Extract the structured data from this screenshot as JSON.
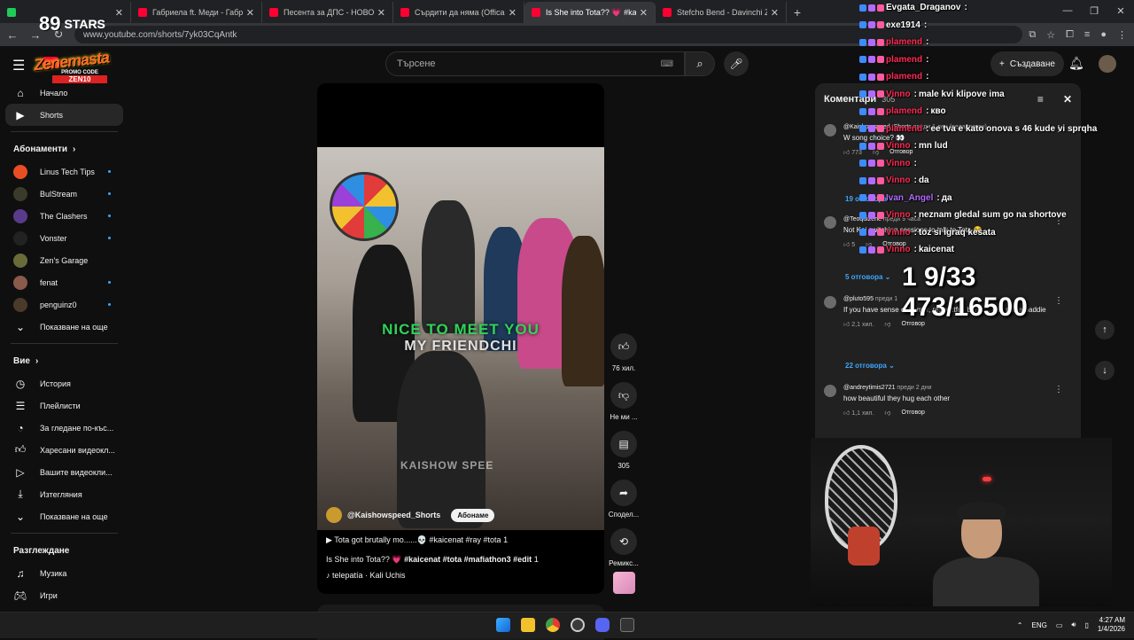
{
  "browser": {
    "tabs": [
      {
        "title": "",
        "favicon": "green"
      },
      {
        "title": "Габриела ft. Меди - Габриела",
        "favicon": "red"
      },
      {
        "title": "Песента за ДПС - НОВО НАЧА",
        "favicon": "red"
      },
      {
        "title": "Сърдити да няма (Offical AI An",
        "favicon": "red"
      },
      {
        "title": "Is She into Tota?? 💗 #kai",
        "favicon": "red",
        "active": true
      },
      {
        "title": "Stefcho Bend - Davinchi Zakon",
        "favicon": "red"
      }
    ],
    "url": "www.youtube.com/shorts/7yk03CqAntk"
  },
  "masthead": {
    "search_placeholder": "Търсене",
    "create_label": "Създаване"
  },
  "sidebar": {
    "top": [
      {
        "label": "Начало",
        "icon": "home-icon"
      },
      {
        "label": "Shorts",
        "icon": "shorts-icon",
        "active": true
      }
    ],
    "subs_header": "Абонаменти",
    "subs": [
      {
        "label": "Linus Tech Tips",
        "color": "#e84d23"
      },
      {
        "label": "BulStream",
        "color": "#3b3b2b"
      },
      {
        "label": "The Clashers",
        "color": "#5a3a8a"
      },
      {
        "label": "Vonster",
        "color": "#222222"
      },
      {
        "label": "Zen's Garage",
        "color": "#6b6b3a"
      },
      {
        "label": "fenat",
        "color": "#8a5a4a"
      },
      {
        "label": "penguinz0",
        "color": "#4a3a2a"
      }
    ],
    "subs_more": "Показване на още",
    "you_header": "Вие",
    "you": [
      {
        "label": "История",
        "icon": "history-icon"
      },
      {
        "label": "Плейлисти",
        "icon": "playlists-icon"
      },
      {
        "label": "За гледане по-къс...",
        "icon": "watch-later-icon"
      },
      {
        "label": "Харесани видеокл...",
        "icon": "liked-icon"
      },
      {
        "label": "Вашите видеокли...",
        "icon": "your-videos-icon"
      },
      {
        "label": "Изтегляния",
        "icon": "downloads-icon"
      }
    ],
    "you_more": "Показване на още",
    "explore_header": "Разглеждане",
    "explore": [
      {
        "label": "Музика",
        "icon": "music-icon"
      },
      {
        "label": "Игри",
        "icon": "games-icon"
      }
    ]
  },
  "video": {
    "caption_green": "NICE TO MEET YOU",
    "caption_white": "MY FRIENDCHI",
    "watermark": "KAISHOW SPEE",
    "channel": "@Kaishowspeed_Shorts",
    "subscribe": "Абонаме",
    "title1": "Tota got brutally mo......💀 #kaicenat #ray #tota",
    "title1_count": "1",
    "title2_prefix": "Is She into Tota?? 💗",
    "title2_tags": "#kaicenat #tota #mafiathon3 #edit",
    "title2_count": "1",
    "music": "telepatía · Kali Uchis"
  },
  "actions": {
    "likes": "76 хил.",
    "dislike": "Не ми ...",
    "comments": "305",
    "share": "Сподел...",
    "remix": "Ремикс..."
  },
  "comments": {
    "title": "Коментари",
    "count": "305",
    "items": [
      {
        "author": "@Kaishowspeed_Shorts",
        "time": "преди 1 ден (редактиран)",
        "text": "W song choice? 👀",
        "likes": "773",
        "reply": "Отговор"
      },
      {
        "author": "@Teoquizene",
        "time": "преди 9 часа",
        "text": "Not Kai switching sessions to talk to Tota 😂",
        "likes": "5",
        "reply": "Отговор"
      },
      {
        "author": "@pluto595",
        "time": "преди 1",
        "text": "If you have sense of humor, respectful, bunk ... can pull a baddie",
        "likes": "2,1 хил.",
        "reply": "Отговор"
      },
      {
        "author": "@andreytimis2721",
        "time": "преди 2 дни",
        "text": "how beautiful they hug each other",
        "likes": "1,1 хил.",
        "reply": "Отговор"
      }
    ],
    "replies": [
      "19 отговора",
      "5 отговора",
      "22 отговора"
    ]
  },
  "overlay": {
    "stars_num": "89",
    "stars_text": "STARS",
    "logo_name": "Zenemasta",
    "promo": "PROMO CODE",
    "promo_code": "ZEN10",
    "counter1": "1 9/33",
    "counter2": "473/16500",
    "chat": [
      {
        "user": "Evgata_Draganov",
        "msg": "",
        "color": "#ffffff"
      },
      {
        "user": "exe1914",
        "msg": "",
        "color": "#ffffff"
      },
      {
        "user": "plamend",
        "msg": "",
        "color": "#ff2a55"
      },
      {
        "user": "plamend",
        "msg": "",
        "color": "#ff2a55"
      },
      {
        "user": "plamend",
        "msg": "",
        "color": "#ff2a55"
      },
      {
        "user": "Vinno",
        "msg": "male kvi klipove ima",
        "color": "#ff2a55"
      },
      {
        "user": "plamend",
        "msg": "кво",
        "color": "#ff2a55"
      },
      {
        "user": "plamend",
        "msg": "ee tva e kato onova s 46 kude vi sprqha",
        "color": "#ff2a55"
      },
      {
        "user": "Vinno",
        "msg": "mn lud",
        "color": "#ff2a55"
      },
      {
        "user": "Vinno",
        "msg": "",
        "color": "#ff2a55"
      },
      {
        "user": "Vinno",
        "msg": "da",
        "color": "#ff2a55"
      },
      {
        "user": "Ivan_Angel",
        "msg": "да",
        "color": "#b36bff"
      },
      {
        "user": "Vinno",
        "msg": "neznam gledal sum go na shortove",
        "color": "#ff2a55"
      },
      {
        "user": "Vinno",
        "msg": "toz si igraq kesata",
        "color": "#ff2a55"
      },
      {
        "user": "Vinno",
        "msg": "kaicenat",
        "color": "#ff2a55"
      }
    ]
  },
  "taskbar": {
    "lang": "ENG",
    "time": "4:27 AM",
    "date": "1/4/2026"
  }
}
